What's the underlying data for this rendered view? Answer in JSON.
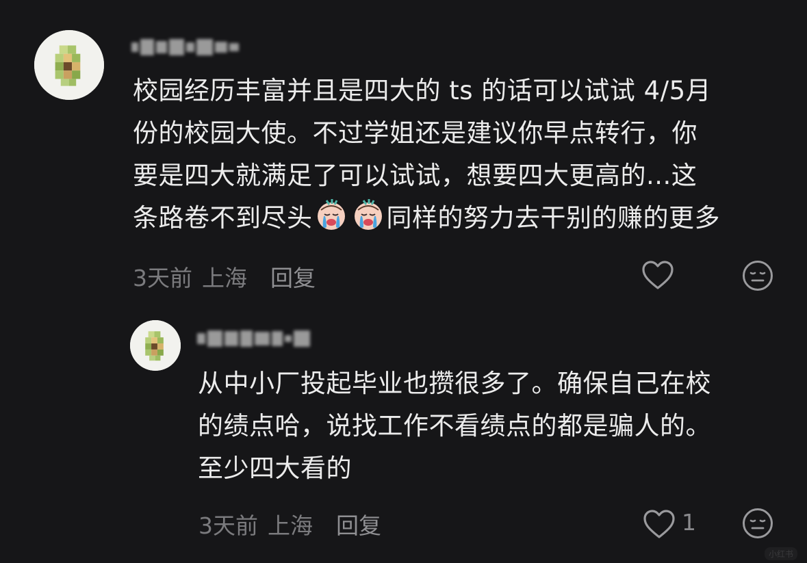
{
  "comment": {
    "username_hint": "",
    "text_line1": "校园经历丰富并且是四大的 ts 的话可以试试 4/5月",
    "text_line2": "份的校园大使。不过学姐还是建议你早点转行，你",
    "text_line3": "要是四大就满足了可以试试，想要四大更高的...这",
    "text_line4_a": "条路卷不到尽头",
    "text_line4_b": "同样的努力去干别的赚的更多",
    "emoji": "crying-face-emoji",
    "time": "3天前",
    "location": "上海",
    "reply_label": "回复",
    "like_count": ""
  },
  "reply": {
    "text_line1": "从中小厂投起毕业也攒很多了。确保自己在校",
    "text_line2": "的绩点哈，说找工作不看绩点的都是骗人的。",
    "text_line3": "至少四大看的",
    "time": "3天前",
    "location": "上海",
    "reply_label": "回复",
    "like_count": "1"
  },
  "watermark": "小红书",
  "colors": {
    "background": "#161618",
    "text": "#ececec",
    "meta": "#7b7b7e",
    "icon": "#9a9a9d"
  }
}
